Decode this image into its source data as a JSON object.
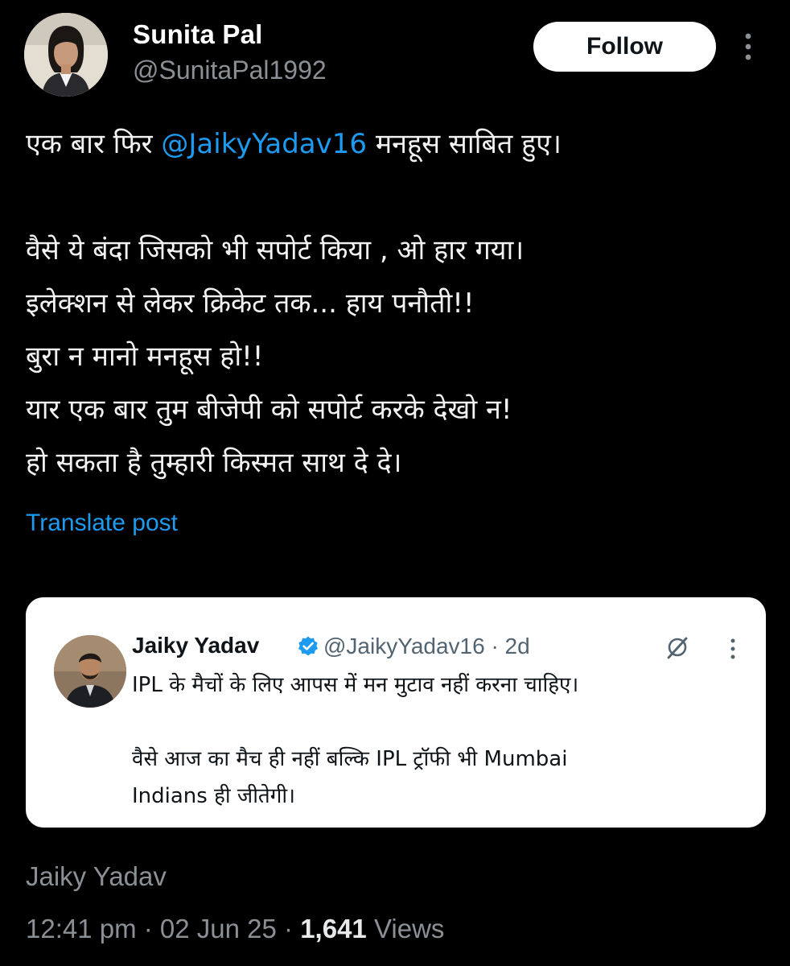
{
  "author": {
    "name": "Sunita Pal",
    "handle": "@SunitaPal1992",
    "avatar_icon": "user-avatar"
  },
  "follow_label": "Follow",
  "tweet": {
    "line1_pre": "एक बार फिर ",
    "line1_mention": "@JaikyYadav16",
    "line1_post": "  मनहूस साबित हुए।",
    "lines": [
      "वैसे ये बंदा जिसको भी सपोर्ट किया , ओ हार गया।",
      "इलेक्शन से लेकर क्रिकेट तक... हाय पनौती!!",
      "बुरा न मानो मनहूस हो!!",
      "यार एक बार तुम बीजेपी को सपोर्ट करके देखो न!",
      "हो सकता है तुम्हारी किस्मत साथ दे दे।"
    ],
    "translate_label": "Translate post"
  },
  "quoted": {
    "name": "Jaiky Yadav",
    "handle_time": "@JaikyYadav16 · 2d",
    "verified_color": "#1d9bf0",
    "line1": "IPL के मैचों के लिए आपस में मन मुटाव नहीं करना चाहिए।",
    "line2": "वैसे आज का मैच ही नहीं बल्कि IPL ट्रॉफी भी Mumbai",
    "line3": "Indians ही जीतेगी।"
  },
  "byline": "Jaiky Yadav",
  "meta": {
    "time_date": "12:41 pm · 02 Jun 25 · ",
    "views_count": "1,641",
    "views_label": " Views"
  },
  "colors": {
    "background": "#000000",
    "accent": "#1d9bf0",
    "secondary_text": "#8b9096"
  }
}
